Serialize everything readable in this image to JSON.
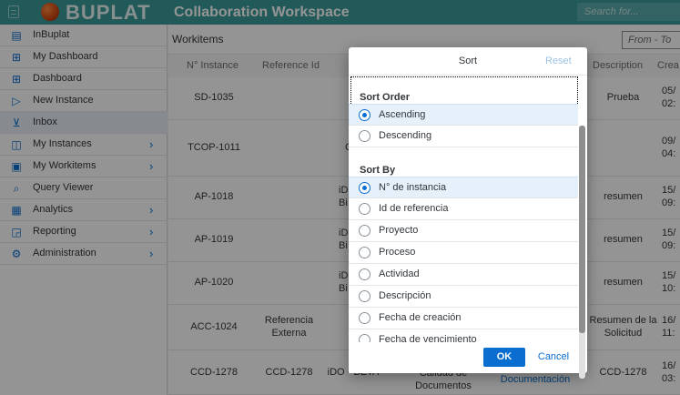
{
  "topbar": {
    "logo_text": "BUPLAT",
    "workspace_title": "Collaboration Workspace",
    "search_placeholder": "Search for...",
    "colors": {
      "bar": "#3a9b99",
      "accent": "#0a6ed1"
    }
  },
  "sidebar": {
    "items": [
      {
        "label": "InBuplat",
        "icon": "document-icon",
        "has_submenu": false
      },
      {
        "label": "My Dashboard",
        "icon": "dashboard-icon",
        "has_submenu": false
      },
      {
        "label": "Dashboard",
        "icon": "dashboard-icon",
        "has_submenu": false
      },
      {
        "label": "New Instance",
        "icon": "play-add-icon",
        "has_submenu": false
      },
      {
        "label": "Inbox",
        "icon": "inbox-icon",
        "has_submenu": false,
        "active": true
      },
      {
        "label": "My Instances",
        "icon": "instances-icon",
        "has_submenu": true
      },
      {
        "label": "My Workitems",
        "icon": "workitems-icon",
        "has_submenu": true
      },
      {
        "label": "Query Viewer",
        "icon": "query-icon",
        "has_submenu": false
      },
      {
        "label": "Analytics",
        "icon": "analytics-icon",
        "has_submenu": true
      },
      {
        "label": "Reporting",
        "icon": "reporting-icon",
        "has_submenu": true
      },
      {
        "label": "Administration",
        "icon": "gear-icon",
        "has_submenu": true
      }
    ]
  },
  "main": {
    "title": "Workitems",
    "date_filter_placeholder": "From - To",
    "columns": [
      "N° Instance",
      "Reference Id",
      "Description",
      "Crea"
    ],
    "rows": [
      {
        "instance": "SD-1035",
        "reference": "",
        "description": "Prueba",
        "created": "05/\n02:"
      },
      {
        "instance": "TCOP-1011",
        "reference": "",
        "description": "",
        "created": "09/\n04:"
      },
      {
        "instance": "AP-1018",
        "reference": "",
        "description": "resumen",
        "created": "15/\n09:"
      },
      {
        "instance": "AP-1019",
        "reference": "",
        "description": "resumen",
        "created": "15/\n09:"
      },
      {
        "instance": "AP-1020",
        "reference": "",
        "description": "resumen",
        "created": "15/\n10:"
      },
      {
        "instance": "ACC-1024",
        "reference": "Referencia\nExterna",
        "description": "Resumen de la\nSolicitud",
        "created": "16/\n11:"
      },
      {
        "instance": "CCD-1278",
        "reference": "CCD-1278",
        "project": "iDO - BETA",
        "process": "Calidad de\nDocumentos",
        "activity": "Documentación",
        "description": "CCD-1278",
        "created": "16/\n03:"
      }
    ],
    "peek_text": [
      "C",
      "iD\nBi",
      "iD\nBi",
      "iD\nBi"
    ]
  },
  "dialog": {
    "title": "Sort",
    "reset_label": "Reset",
    "sort_order_title": "Sort Order",
    "sort_order_options": [
      {
        "label": "Ascending",
        "selected": true
      },
      {
        "label": "Descending",
        "selected": false
      }
    ],
    "sort_by_title": "Sort By",
    "sort_by_options": [
      {
        "label": "N° de instancia",
        "selected": true
      },
      {
        "label": "Id de referencia",
        "selected": false
      },
      {
        "label": "Proyecto",
        "selected": false
      },
      {
        "label": "Proceso",
        "selected": false
      },
      {
        "label": "Actividad",
        "selected": false
      },
      {
        "label": "Descripción",
        "selected": false
      },
      {
        "label": "Fecha de creación",
        "selected": false
      },
      {
        "label": "Fecha de vencimiento",
        "selected": false
      }
    ],
    "ok_label": "OK",
    "cancel_label": "Cancel"
  }
}
